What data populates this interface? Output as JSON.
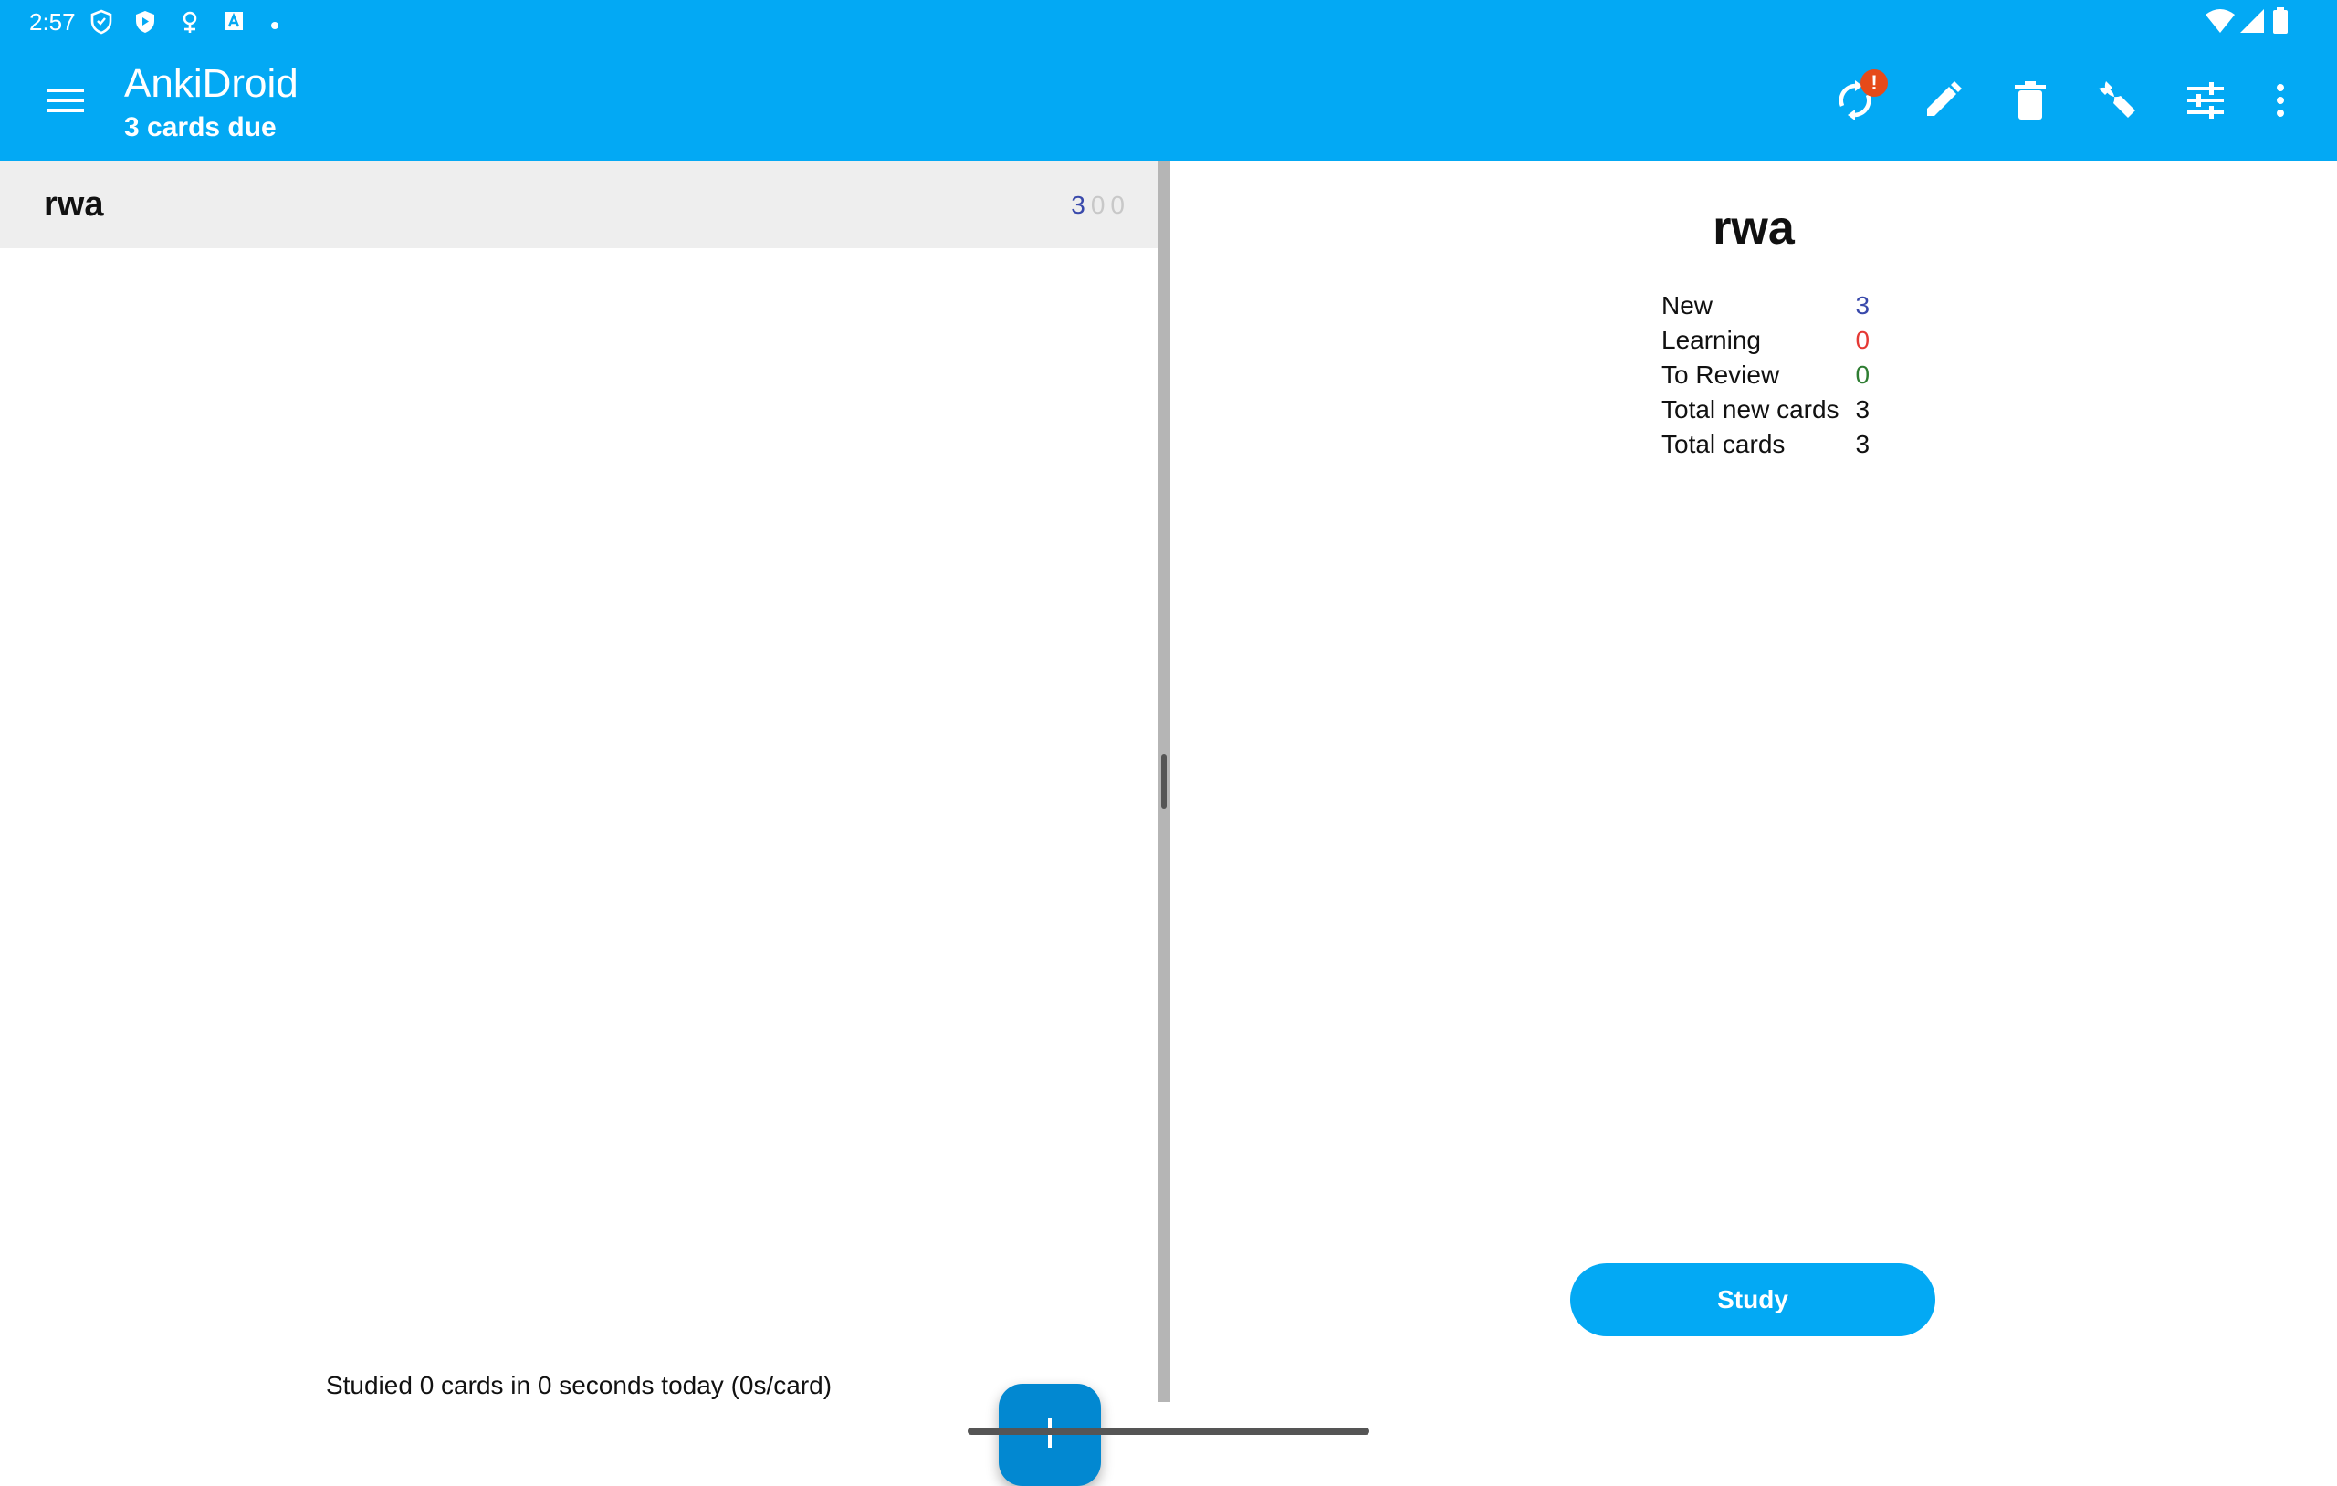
{
  "status_bar": {
    "time": "2:57"
  },
  "toolbar": {
    "title": "AnkiDroid",
    "subtitle": "3 cards due",
    "sync_badge": "!",
    "icons": [
      "menu-icon",
      "sync-icon",
      "edit-icon",
      "delete-icon",
      "wrench-icon",
      "tune-icon",
      "more-vert-icon"
    ]
  },
  "deck_list": {
    "items": [
      {
        "name": "rwa",
        "new": "3",
        "learning": "0",
        "review": "0"
      }
    ],
    "studied_summary": "Studied 0 cards in 0 seconds today (0s/card)"
  },
  "overview": {
    "title": "rwa",
    "stats": [
      {
        "label": "New",
        "value": "3"
      },
      {
        "label": "Learning",
        "value": "0"
      },
      {
        "label": "To Review",
        "value": "0"
      },
      {
        "label": "Total new cards",
        "value": "3"
      },
      {
        "label": "Total cards",
        "value": "3"
      }
    ],
    "study_label": "Study"
  },
  "colors": {
    "primary": "#03a9f4",
    "fab": "#0288d1",
    "new_count": "#3949ab",
    "learning_count": "#e53935",
    "review_count": "#2e7d32",
    "badge": "#e64a19"
  }
}
